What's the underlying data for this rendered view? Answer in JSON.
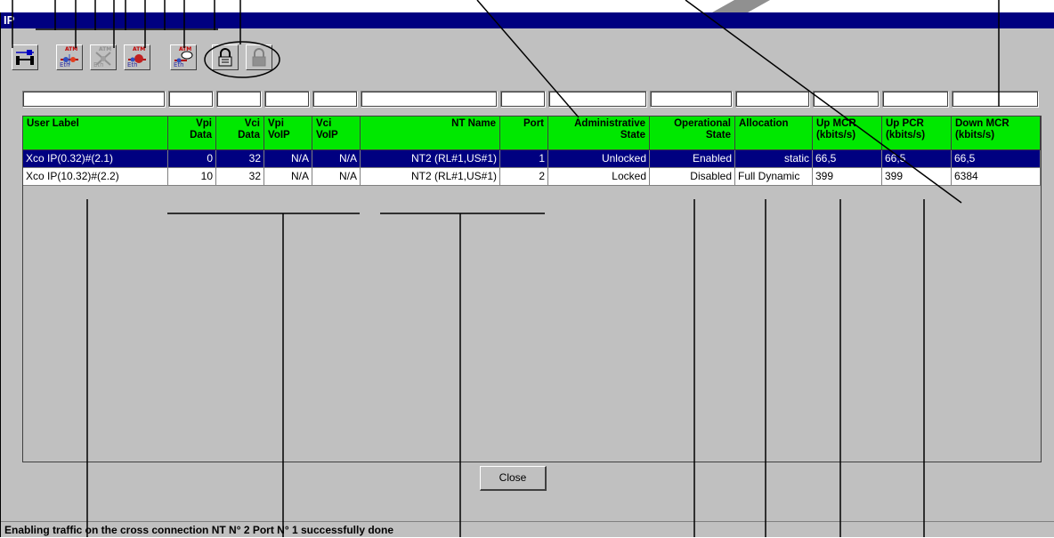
{
  "window": {
    "title": "IP"
  },
  "toolbar": {
    "buttons": [
      {
        "name": "connection-tool-icon"
      },
      {
        "name": "atm-eth-create-icon",
        "atm": "ATM",
        "eth": "Eth"
      },
      {
        "name": "atm-eth-delete-icon",
        "atm": "ATM",
        "eth": "Eth"
      },
      {
        "name": "atm-eth-modify-icon",
        "atm": "ATM",
        "eth": "Eth"
      },
      {
        "name": "atm-eth-query-icon",
        "atm": "ATM",
        "eth": "Eth"
      },
      {
        "name": "lock-icon"
      },
      {
        "name": "unlock-icon"
      }
    ]
  },
  "filters": [
    "",
    "",
    "",
    "",
    "",
    "",
    "",
    "",
    "",
    "",
    "",
    "",
    ""
  ],
  "table": {
    "columns": [
      "User Label",
      "Vpi\nData",
      "Vci\nData",
      "Vpi\nVoIP",
      "Vci\nVoIP",
      "NT Name",
      "Port",
      "Administrative\nState",
      "Operational\nState",
      "Allocation",
      "Up MCR\n(kbits/s)",
      "Up PCR\n(kbits/s)",
      "Down MCR\n(kbits/s)"
    ],
    "rows": [
      [
        "Xco IP(0.32)#(2.1)",
        "0",
        "32",
        "N/A",
        "N/A",
        "NT2 (RL#1,US#1)",
        "1",
        "Unlocked",
        "Enabled",
        "static",
        "66,5",
        "66,5",
        "66,5"
      ],
      [
        "Xco IP(10.32)#(2.2)",
        "10",
        "32",
        "N/A",
        "N/A",
        "NT2 (RL#1,US#1)",
        "2",
        "Locked",
        "Disabled",
        "Full Dynamic",
        "399",
        "399",
        "6384"
      ]
    ],
    "selected_row": 0
  },
  "close_button": {
    "label": "Close"
  },
  "status": {
    "text": "Enabling traffic on the cross connection NT N° 2 Port N° 1 successfully done"
  }
}
